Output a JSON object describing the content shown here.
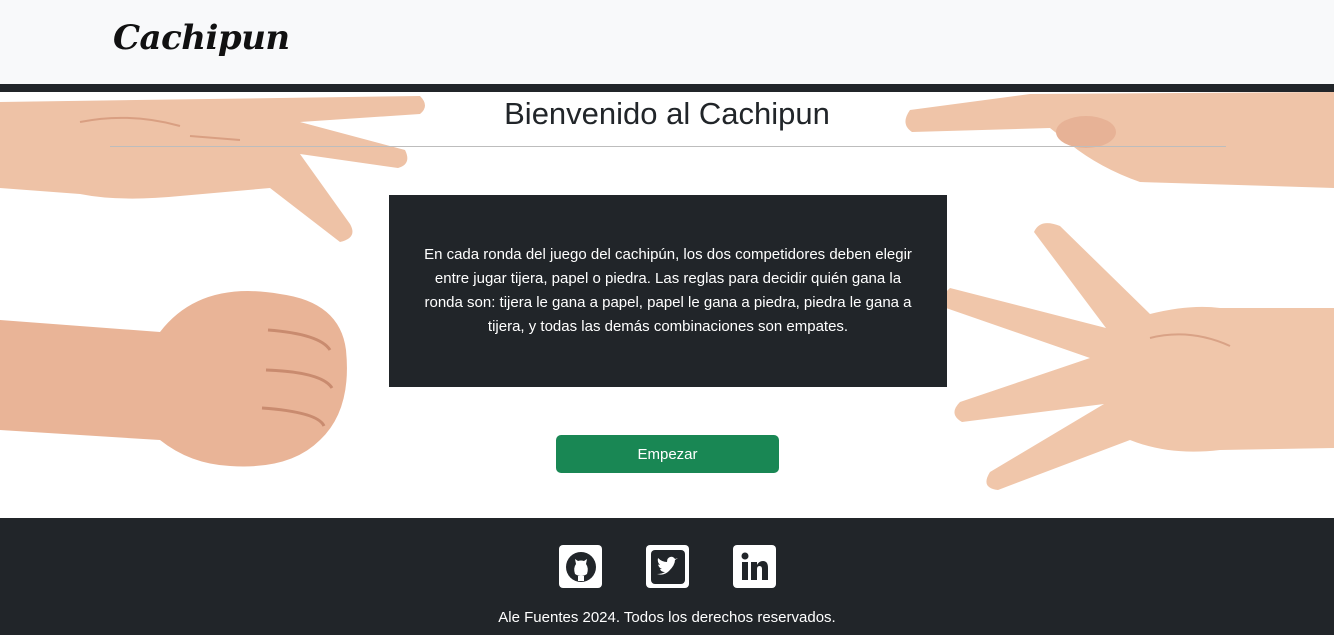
{
  "header": {
    "brand": "Cachipun"
  },
  "hero": {
    "title": "Bienvenido al Cachipun",
    "rules": "En cada ronda del juego del cachipún, los dos competidores deben elegir entre jugar tijera, papel o piedra. Las reglas para decidir quién gana la ronda son: tijera le gana a papel, papel le gana a piedra, piedra le gana a tijera, y todas las demás combinaciones son empates.",
    "start_label": "Empezar"
  },
  "footer": {
    "social": [
      {
        "icon": "github-icon",
        "label": "GitHub"
      },
      {
        "icon": "twitter-icon",
        "label": "Twitter"
      },
      {
        "icon": "linkedin-icon",
        "label": "LinkedIn"
      }
    ],
    "copyright": "Ale Fuentes 2024. Todos los derechos reservados."
  },
  "colors": {
    "navbar_bg": "#f8f9fa",
    "dark": "#212529",
    "button": "#198754",
    "skin": "#f0c4a6"
  }
}
